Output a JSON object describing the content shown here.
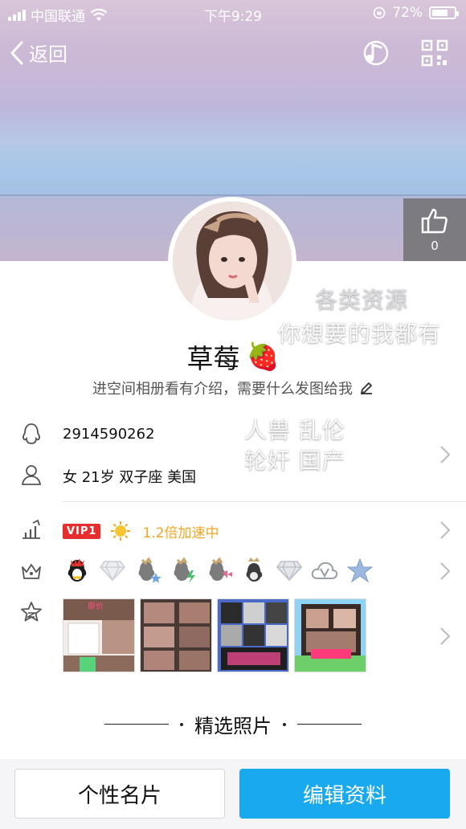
{
  "status_bar": {
    "carrier": "中国联通",
    "time": "下午9:29",
    "battery": "72%",
    "battery_level": 0.72
  },
  "nav": {
    "back_label": "返回",
    "music_icon": "music-note-icon",
    "qr_icon": "qr-code-icon"
  },
  "like": {
    "count": "0",
    "icon": "thumbs-up-icon"
  },
  "profile": {
    "name": "草莓",
    "name_emoji": "🍓",
    "bio": "进空间相册看有介绍，需要什么发图给我"
  },
  "watermarks": {
    "line1": "各类资源",
    "line2": "你想要的我都有",
    "line3": "人兽 乱伦",
    "line4": "轮奸 国产"
  },
  "info": {
    "qq_number": "2914590262",
    "details": "女 21岁 双子座 美国"
  },
  "vip": {
    "badge": "VIP1",
    "speed": "1.2倍加速中"
  },
  "section": {
    "selected_photos": "精选照片"
  },
  "buttons": {
    "card": "个性名片",
    "edit": "编辑资料"
  },
  "colors": {
    "accent": "#19a9ee",
    "vip_red": "#e62e2e",
    "speed_orange": "#f5a623"
  }
}
